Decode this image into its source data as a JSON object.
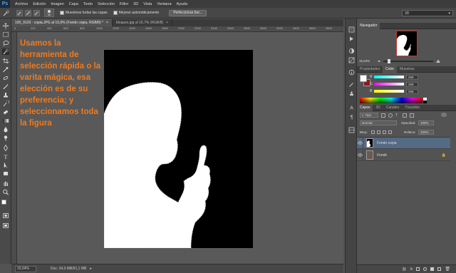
{
  "app": {
    "logo": "Ps"
  },
  "menu": [
    "Archivo",
    "Edición",
    "Imagen",
    "Capa",
    "Texto",
    "Selección",
    "Filtro",
    "3D",
    "Vista",
    "Ventana",
    "Ayuda"
  ],
  "options": {
    "brush_size": "30",
    "sample_all_layers": "Muestrear todas las capas",
    "auto_enhance": "Mejorar automáticamente",
    "refine_edge": "Perfeccionar bor...",
    "workspace": "3D"
  },
  "tabs": [
    {
      "label": "100_9129 - copia.JPG al 15,6% (Fondo copia, RGB/8) *",
      "close": "×"
    },
    {
      "label": "bloques.jpg al 16,7% (RGB/8)",
      "close": "×"
    }
  ],
  "ruler_ticks": [
    "0",
    "200",
    "400",
    "600",
    "800",
    "1000",
    "1200",
    "1400",
    "1600",
    "1800",
    "2000",
    "2200",
    "2400",
    "2600",
    "2800",
    "3000",
    "3200",
    "3400",
    "3600",
    "3800"
  ],
  "overlay_text": "Usamos la herramienta de selección rápida o la varita mágica, esa elección es de su preferencia; y seleccionamos toda la figura",
  "status": {
    "zoom": "15,64%",
    "doc": "Doc: 34,3 MB/51,1 MB"
  },
  "navigator": {
    "tab": "Navegador",
    "zoom": "15,64%"
  },
  "color_panel": {
    "tabs": [
      "Propiedades",
      "Color",
      "Muestras"
    ],
    "active_tab": "Color",
    "channels": [
      {
        "label": "R",
        "value": "255"
      },
      {
        "label": "G",
        "value": "255"
      },
      {
        "label": "B",
        "value": "255"
      }
    ]
  },
  "layers_panel": {
    "tabs": [
      "Capas",
      "3D",
      "Canales",
      "Trazados"
    ],
    "active_tab": "Capas",
    "filter": "Tipo",
    "blend_mode": "Normal",
    "opacity_label": "Opacidad:",
    "opacity_value": "100%",
    "lock_label": "Bloq.:",
    "fill_label": "Relleno:",
    "fill_value": "100%",
    "layers": [
      {
        "name": "Fondo copia",
        "selected": true
      },
      {
        "name": "Fondo",
        "selected": false
      }
    ]
  },
  "colors": {
    "accent_orange": "#f07a1e",
    "selected_layer": "#546a85",
    "canvas_bg": "#000000",
    "figure": "#ffffff"
  }
}
